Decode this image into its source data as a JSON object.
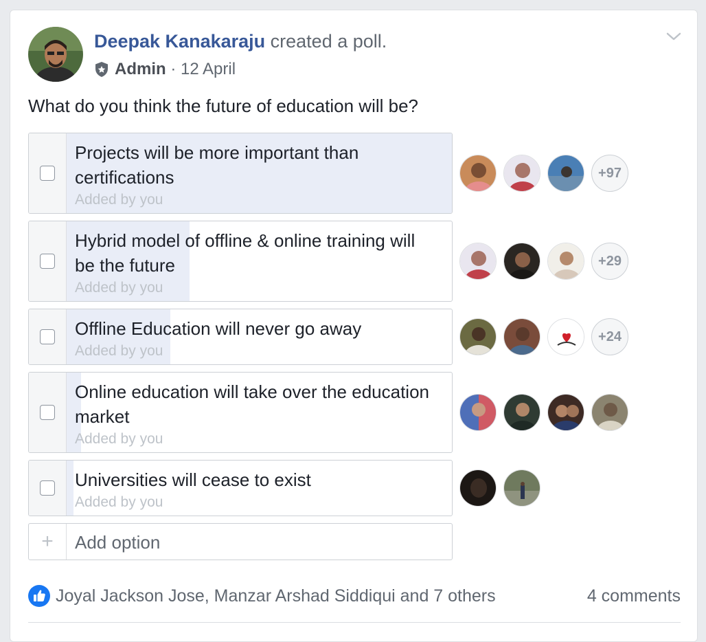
{
  "post": {
    "author": "Deepak Kanakaraju",
    "action": "created a poll.",
    "role": "Admin",
    "separator": " · ",
    "date": "12 April",
    "question": "What do you think the future of education will be?"
  },
  "poll": {
    "options": [
      {
        "label": "Projects will be more important than certifications",
        "added_by": "Added by you",
        "vote_fill": 1.0,
        "more_voters": "+97",
        "voter_colors": [
          "#c98b5a",
          "#a8766a",
          "#4a7fb5"
        ]
      },
      {
        "label": "Hybrid model of offline & online training will be the future",
        "added_by": "Added by you",
        "vote_fill": 0.32,
        "more_voters": "+29",
        "voter_colors": [
          "#a8766a",
          "#3b3128",
          "#d7c8ba"
        ]
      },
      {
        "label": "Offline Education will never go away",
        "added_by": "Added by you",
        "vote_fill": 0.27,
        "more_voters": "+24",
        "voter_colors": [
          "#6b6a42",
          "#7a4c3b",
          "#ffffff"
        ]
      },
      {
        "label": "Online education will take over the education market",
        "added_by": "Added by you",
        "vote_fill": 0.04,
        "more_voters": "",
        "voter_colors": [
          "#d05a64",
          "#2f3b33",
          "#3d2a24",
          "#8b8470"
        ]
      },
      {
        "label": "Universities will cease to exist",
        "added_by": "Added by you",
        "vote_fill": 0.02,
        "more_voters": "",
        "voter_colors": [
          "#1c1714",
          "#6f7a5e"
        ]
      }
    ],
    "add_option_placeholder": "Add option"
  },
  "footer": {
    "likes_text": "Joyal Jackson Jose, Manzar Arshad Siddiqui and 7 others",
    "comments_text": "4 comments"
  },
  "colors": {
    "brand_blue": "#385898",
    "like_blue": "#1877f2",
    "fill_blue": "#e9edf7"
  },
  "icons": {
    "header_chevron": "chevron-down-icon",
    "role_badge": "shield-icon",
    "like": "like-icon",
    "add": "plus-icon"
  }
}
